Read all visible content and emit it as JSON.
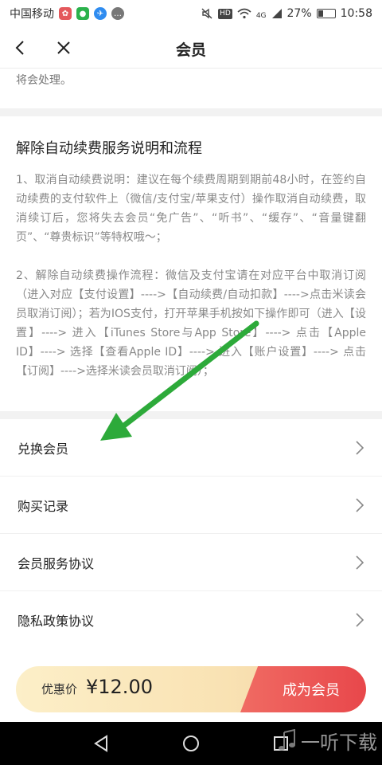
{
  "status_bar": {
    "carrier": "中国移动",
    "network": "4G",
    "battery": "27%",
    "battery_level": 0.27,
    "time": "10:58",
    "hd": "HD"
  },
  "nav": {
    "title": "会员"
  },
  "intro": {
    "tail_text": "将会处理。"
  },
  "info": {
    "title": "解除自动续费服务说明和流程",
    "para1": "1、取消自动续费说明：建议在每个续费周期到期前48小时，在签约自动续费的支付软件上（微信/支付宝/苹果支付）操作取消自动续费，取消续订后，您将失去会员“免广告”、“听书”、“缓存”、“音量键翻页”、“尊贵标识”等特权哦～；",
    "para2": "2、解除自动续费操作流程：微信及支付宝请在对应平台中取消订阅（进入对应【支付设置】---->【自动续费/自动扣款】---->点击米读会员取消订阅）；若为IOS支付，打开苹果手机按如下操作即可（进入【设置】----> 进入【iTunes Store与App Store】----> 点击【Apple ID】----> 选择【查看Apple ID】----> 进入【账户设置】----> 点击【订阅】---->选择米读会员取消订阅）；"
  },
  "menu": {
    "items": [
      {
        "label": "兑换会员"
      },
      {
        "label": "购买记录"
      },
      {
        "label": "会员服务协议"
      },
      {
        "label": "隐私政策协议"
      }
    ]
  },
  "purchase": {
    "price_label": "优惠价",
    "price": "¥12.00",
    "join_label": "成为会员"
  },
  "watermark": {
    "text": "一听下载"
  },
  "colors": {
    "accent": "#e8474b",
    "annotation_arrow": "#2daa3a",
    "price_bar": "#f9e2b3"
  },
  "icons": {
    "back": "chevron-left-icon",
    "close": "close-icon",
    "menu_arrow": "chevron-right-icon",
    "sys_back": "triangle-back-icon",
    "sys_home": "circle-home-icon",
    "sys_recent": "square-recent-icon"
  }
}
